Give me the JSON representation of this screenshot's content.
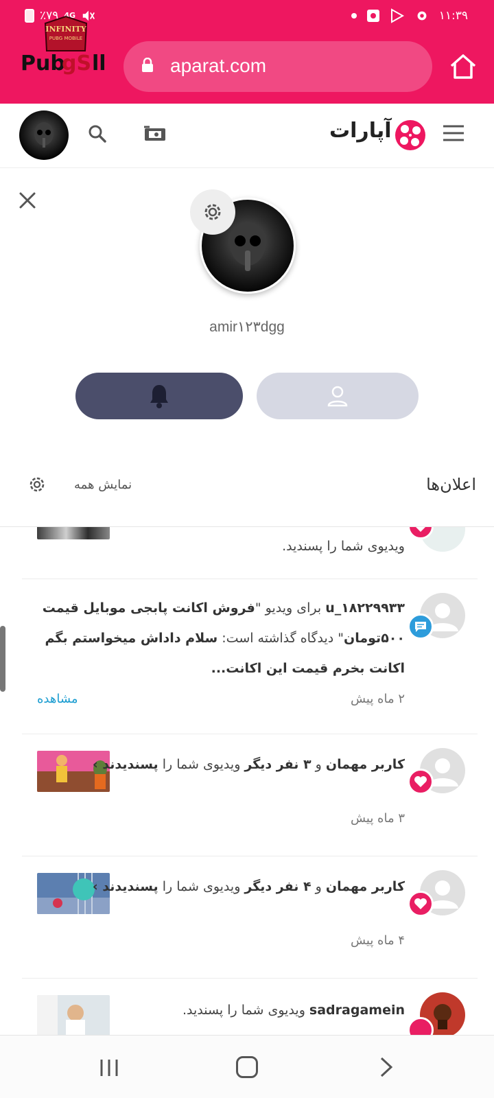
{
  "status_bar": {
    "battery_text": "٪۷۹",
    "network": "4G",
    "time": "۱۱:۳۹"
  },
  "logo_stamp": {
    "line1": "INFINITY",
    "line2": "PUBG MOBILE",
    "brand": "PubgSell"
  },
  "browser": {
    "url": "aparat.com",
    "icons": [
      "lock-icon",
      "home-icon"
    ]
  },
  "app_header": {
    "brand_name": "آپارات",
    "icons": [
      "menu-icon",
      "aparat-logo",
      "upload-video-icon",
      "search-icon",
      "user-avatar"
    ]
  },
  "profile": {
    "username": "amir۱۲۳dgg",
    "buttons": [
      "notifications-button",
      "profile-button"
    ]
  },
  "notifications_panel": {
    "title": "اعلان‌ها",
    "show_all": "نمایش همه",
    "items": [
      {
        "text": "ویدیوی شما را پسندید.",
        "badge": "heart"
      },
      {
        "actor": "u_۱۸۲۲۹۹۳۳",
        "text_1": " برای ویدیو \"",
        "video_title": "فروش اکانت پابجی موبایل قیمت ۵۰۰تومان",
        "text_2": "\" دیدگاه گذاشته است: ",
        "comment": "سلام داداش میخواستم بگم اکانت بخرم قیمت این اکانت...",
        "time": "۲ ماه پیش",
        "action": "مشاهده",
        "badge": "comment"
      },
      {
        "actor": "کاربر مهمان",
        "text": " و ",
        "others": "۳ نفر دیگر",
        "text_2": " ویدیوی شما را ",
        "text_3": "پسندیدند ›",
        "time": "۳ ماه پیش",
        "badge": "heart"
      },
      {
        "actor": "کاربر مهمان",
        "text": " و ",
        "others": "۴ نفر دیگر",
        "text_2": " ویدیوی شما را ",
        "text_3": "پسندیدند ›",
        "time": "۴ ماه پیش",
        "badge": "heart"
      },
      {
        "actor": "sadragamein",
        "text": " ویدیوی شما را پسندید.",
        "badge": "heart"
      }
    ]
  },
  "colors": {
    "brand_pink": "#ee1760",
    "heart_badge": "#e91e63",
    "comment_badge": "#2d9cdb",
    "bell_button": "#4b4e6b",
    "profile_button": "#d6d8e3",
    "link": "#1a9cd0"
  }
}
